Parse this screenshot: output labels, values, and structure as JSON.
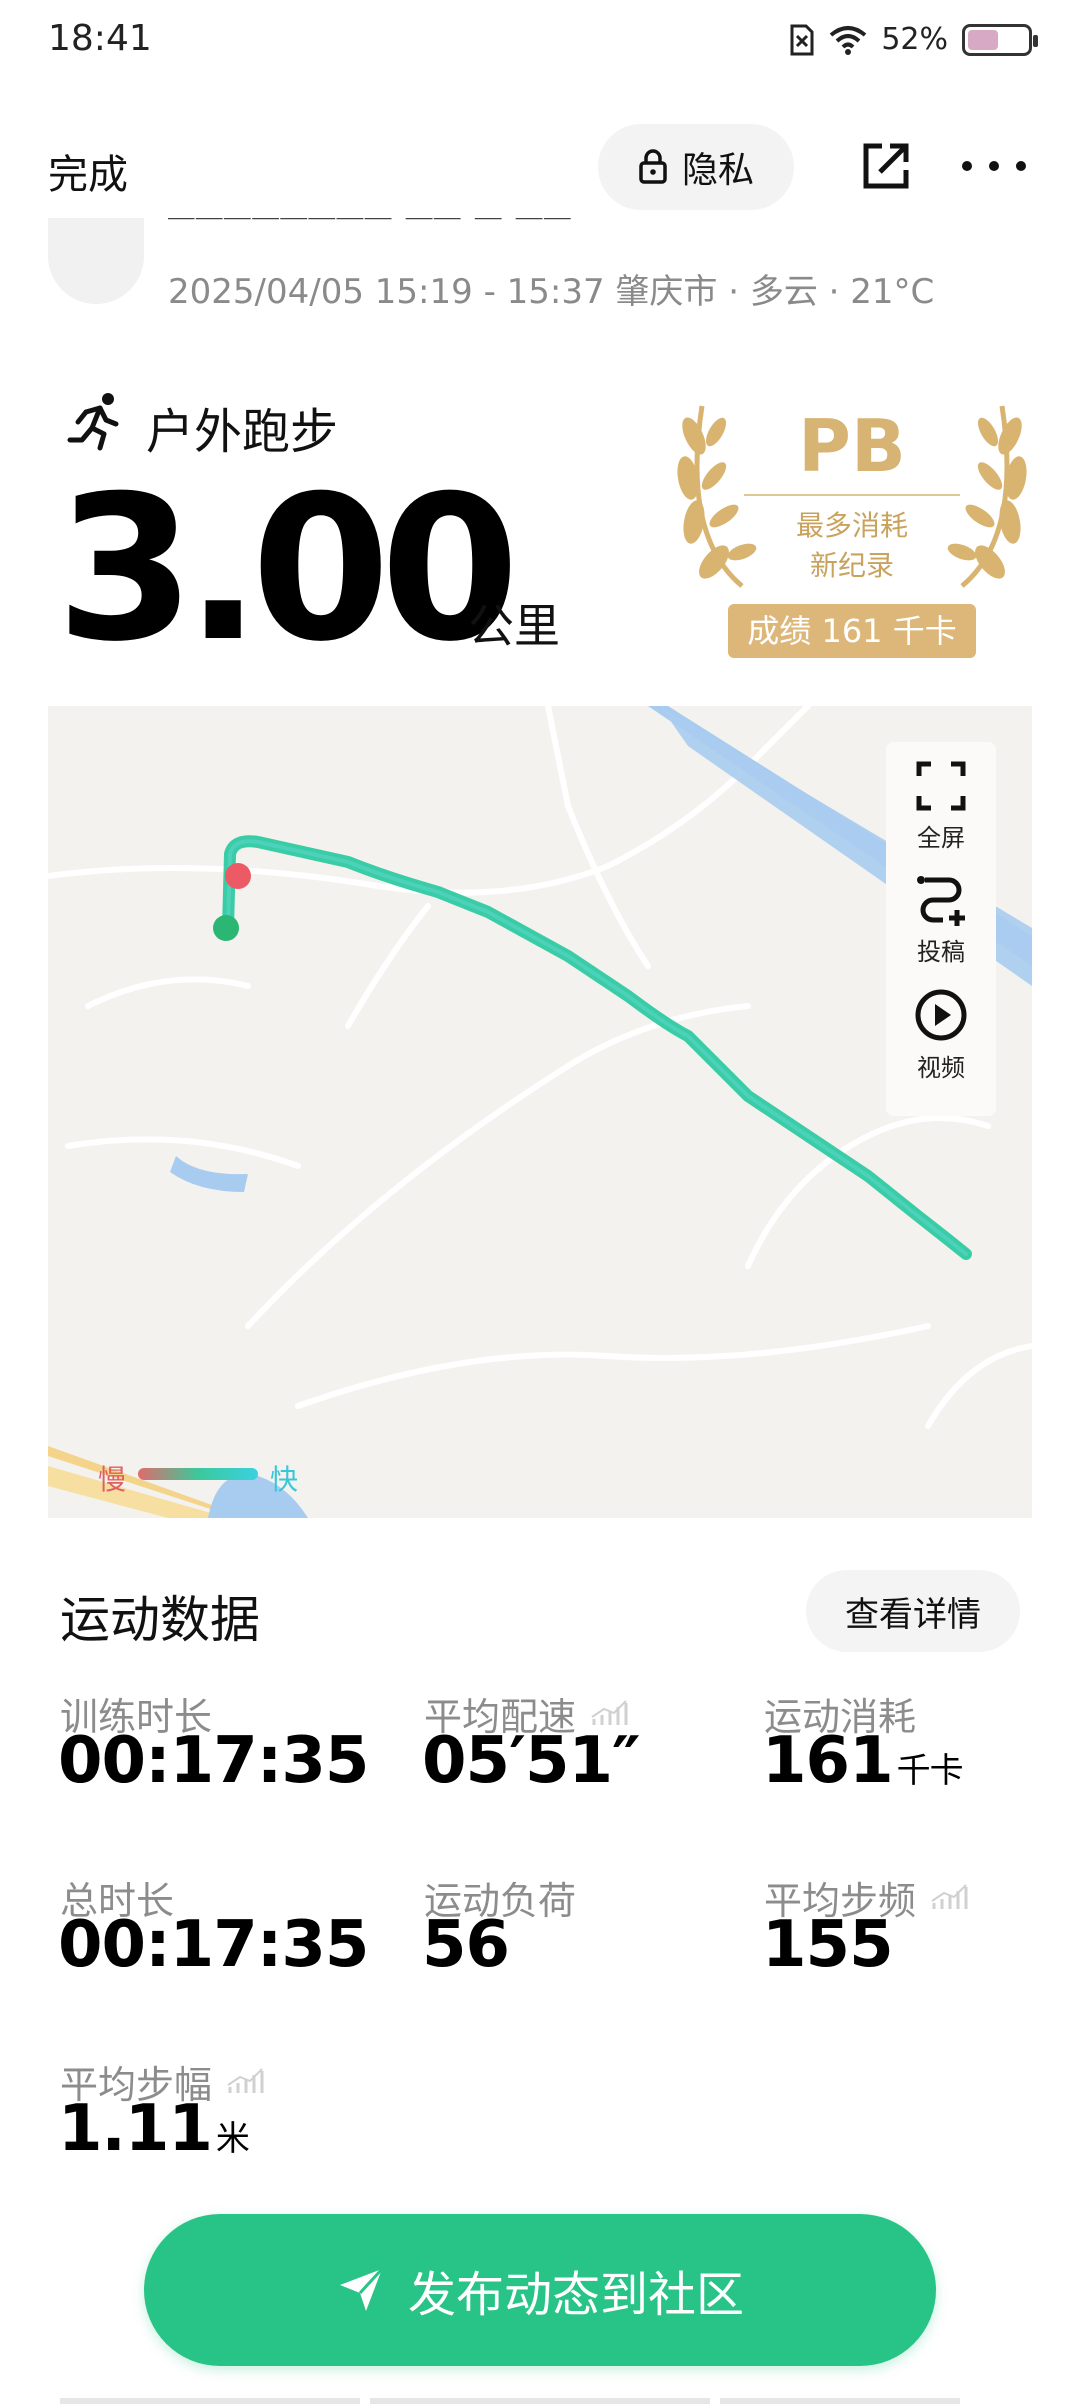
{
  "status_bar": {
    "time": "18:41",
    "battery": "52%",
    "battery_level": 0.52
  },
  "topbar": {
    "done": "完成",
    "privacy": "隐私"
  },
  "meta": {
    "line": "2025/04/05 15:19 - 15:37 肇庆市 · 多云 · 21°C"
  },
  "activity": {
    "type": "户外跑步",
    "distance": "3.00",
    "unit": "公里"
  },
  "pb": {
    "title": "PB",
    "sub1": "最多消耗",
    "sub2": "新纪录",
    "score": "成绩 161 千卡"
  },
  "map": {
    "tools": [
      {
        "label": "全屏",
        "icon": "fullscreen-icon"
      },
      {
        "label": "投稿",
        "icon": "route-add-icon"
      },
      {
        "label": "视频",
        "icon": "play-icon"
      }
    ],
    "legend": {
      "slow": "慢",
      "fast": "快"
    },
    "colors": {
      "route": "#2fc9a0",
      "start": "#2bb673",
      "end": "#ec5a66",
      "water": "#a8ccf0",
      "road": "#f6dfa0"
    }
  },
  "stats": {
    "title": "运动数据",
    "details_button": "查看详情",
    "items": [
      {
        "label": "训练时长",
        "value": "00:17:35",
        "unit": ""
      },
      {
        "label": "平均配速",
        "value": "05′51″",
        "unit": ""
      },
      {
        "label": "运动消耗",
        "value": "161",
        "unit": "千卡"
      },
      {
        "label": "总时长",
        "value": "00:17:35",
        "unit": ""
      },
      {
        "label": "运动负荷",
        "value": "56",
        "unit": ""
      },
      {
        "label": "平均步频",
        "value": "155",
        "unit": ""
      },
      {
        "label": "平均步幅",
        "value": "1.11",
        "unit": "米"
      }
    ]
  },
  "publish": {
    "label": "发布动态到社区"
  }
}
